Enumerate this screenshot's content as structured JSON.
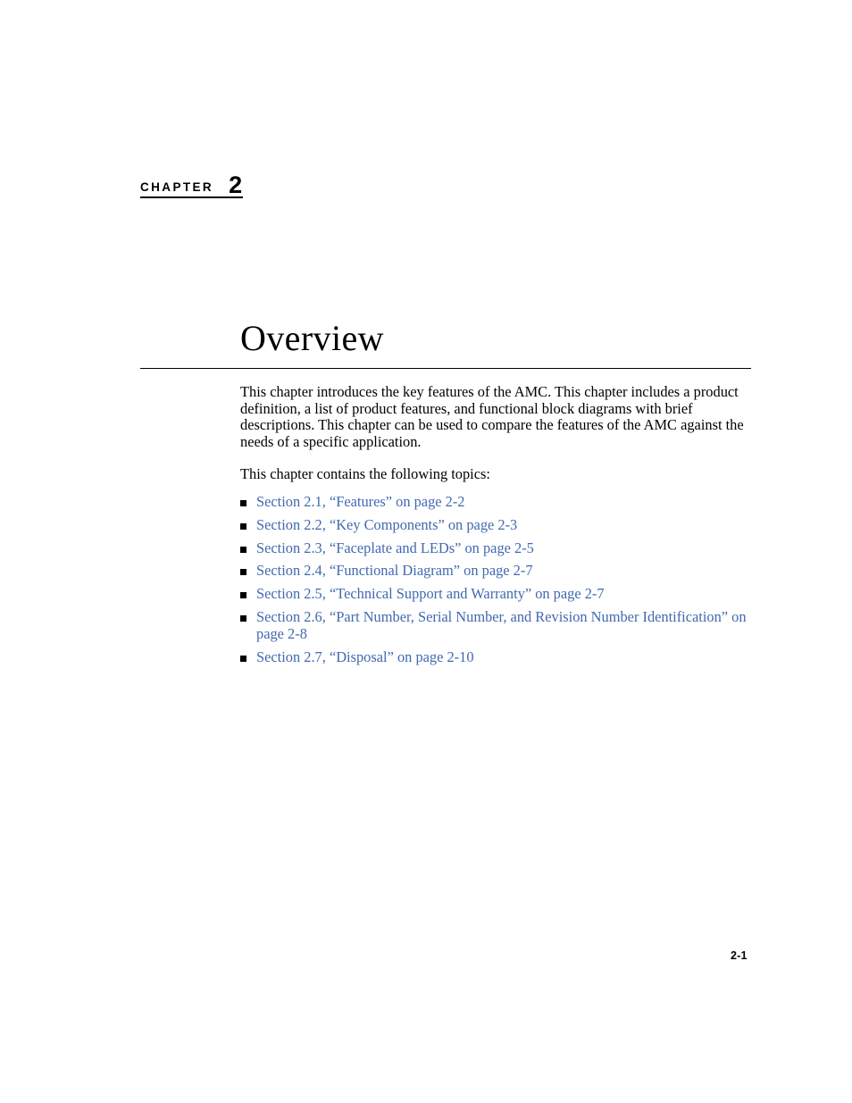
{
  "document": {
    "chapter_label": "CHAPTER",
    "chapter_number": "2",
    "title": "Overview",
    "page_number": "2-1"
  },
  "colors": {
    "link": "#4169B0",
    "text": "#000000",
    "rule": "#000000",
    "background": "#ffffff"
  },
  "body": {
    "intro_paragraph": "This chapter introduces the key features of the AMC. This chapter includes a product definition, a list of product features, and functional block diagrams with brief descriptions. This chapter can be used to compare the features of the AMC against the needs of a specific application.",
    "topics_lead": "This chapter contains the following topics:"
  },
  "topics": [
    {
      "label": "Section 2.1, “Features” on page 2-2"
    },
    {
      "label": "Section 2.2, “Key Components” on page 2-3"
    },
    {
      "label": "Section 2.3, “Faceplate and LEDs” on page 2-5"
    },
    {
      "label": "Section 2.4, “Functional Diagram” on page 2-7"
    },
    {
      "label": "Section 2.5, “Technical Support and Warranty” on page 2-7"
    },
    {
      "label": "Section 2.6, “Part Number, Serial Number, and Revision Number Identification” on page 2-8"
    },
    {
      "label": "Section 2.7, “Disposal” on page 2-10"
    }
  ]
}
